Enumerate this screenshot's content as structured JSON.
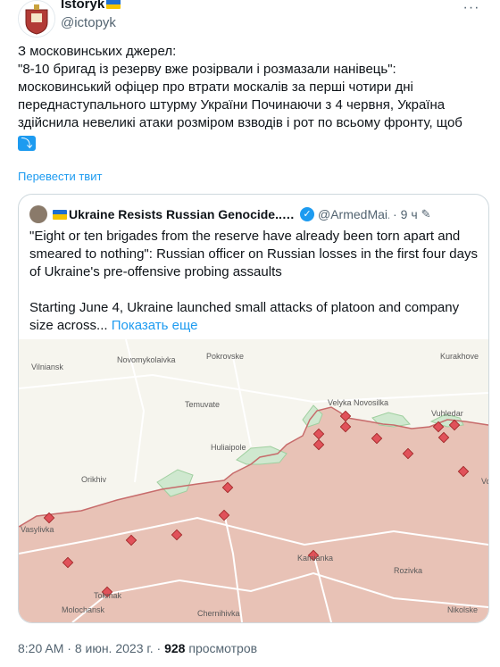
{
  "author": {
    "display_name": "Istoryk",
    "handle": "@ictopyk"
  },
  "tweet": {
    "text": "З московинських джерел:\n\"8-10 бригад із резерву вже розірвали і розмазали нанівець\": московинський офіцер про втрати москалів за перші чотири дні переднаступального штурму України Починаючи з 4 червня, Україна здійснила невеликі атаки розміром взводів і рот по всьому фронту, щоб",
    "translate_label": "Перевести твит"
  },
  "quote": {
    "display_name": "Ukraine Resists Russian Genocide... Yeah ...",
    "handle": "@ArmedMai...",
    "dot": "·",
    "time": "9 ч",
    "text": "\"Eight or ten brigades from the reserve have already been torn apart and smeared to nothing\": Russian officer on Russian losses in the first four days of Ukraine's pre-offensive probing assaults\n\nStarting June 4, Ukraine launched small attacks of platoon and company size across...",
    "show_more": "Показать еще"
  },
  "map": {
    "labels": [
      "Vilniansk",
      "Novomykolaivka",
      "Pokrovske",
      "Kurakhove",
      "Velyka Novosilka",
      "Temuvate",
      "Huliaipole",
      "Orikhiv",
      "Vuhledar",
      "Tokmak",
      "Molochansk",
      "Kamianka",
      "Rozivka",
      "Chernihivka",
      "Nikolske",
      "Vo",
      "Vasylivka"
    ],
    "colors": {
      "russian_control": "#e8c2b6",
      "contested": "#cfe8cf",
      "free": "#f6f5ee",
      "road": "#ffffff",
      "marker": "#e0525a"
    }
  },
  "footer": {
    "time": "8:20 AM",
    "sep": "·",
    "date": "8 июн. 2023 г.",
    "views_count": "928",
    "views_label": "просмотров"
  }
}
